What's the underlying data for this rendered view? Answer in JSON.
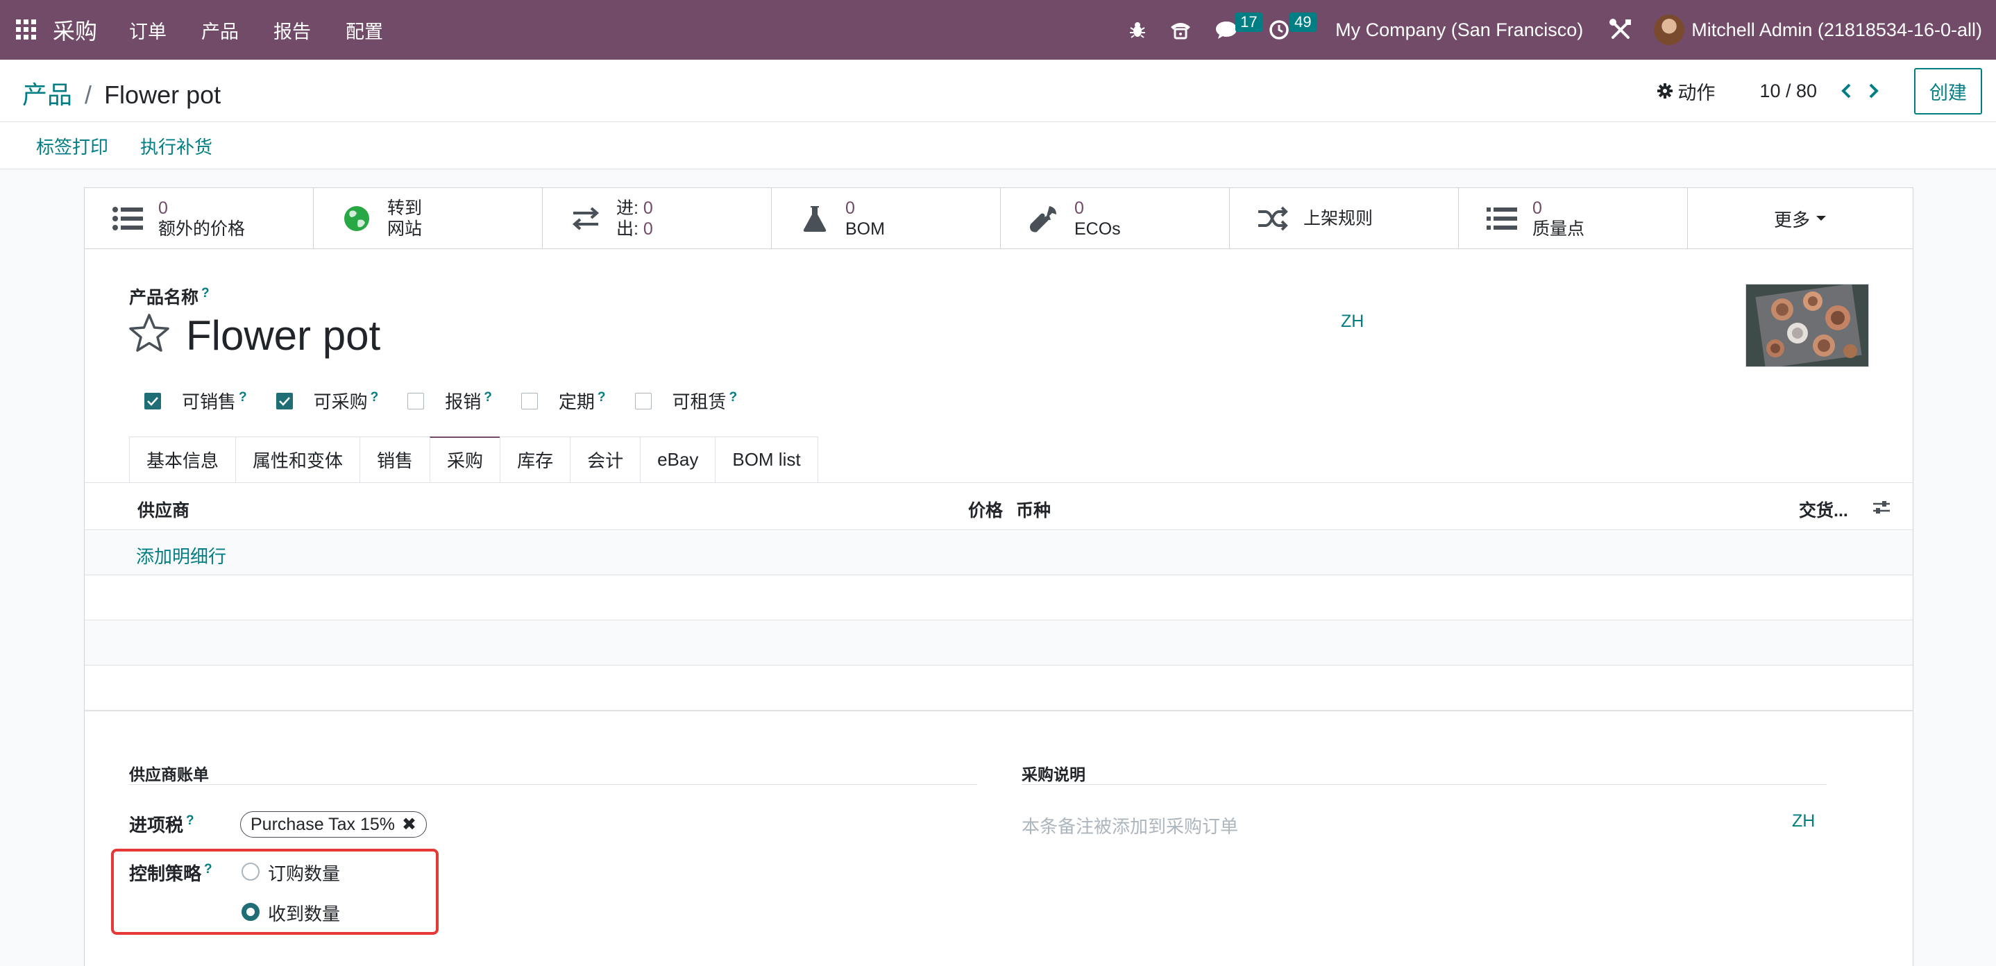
{
  "navbar": {
    "app_name": "采购",
    "menus": [
      "订单",
      "产品",
      "报告",
      "配置"
    ],
    "messages_count": "17",
    "activities_count": "49",
    "company": "My Company (San Francisco)",
    "user": "Mitchell Admin (21818534-16-0-all)",
    "color": "#714B67"
  },
  "control_panel": {
    "breadcrumb_parent": "产品",
    "breadcrumb_sep": "/",
    "breadcrumb_current": "Flower pot",
    "action_label": "动作",
    "pager": "10 / 80",
    "create_label": "创建"
  },
  "header_buttons": [
    "标签打印",
    "执行补货"
  ],
  "smart_buttons": [
    {
      "value": "0",
      "label": "额外的价格",
      "icon": "list-icon"
    },
    {
      "value": "转到",
      "label": "网站",
      "icon": "globe-icon"
    },
    {
      "in_label": "进:",
      "in_value": "0",
      "out_label": "出:",
      "out_value": "0",
      "icon": "transfer-icon"
    },
    {
      "value": "0",
      "label": "BOM",
      "icon": "flask-icon"
    },
    {
      "value": "0",
      "label": "ECOs",
      "icon": "wrench-icon"
    },
    {
      "label": "上架规则",
      "icon": "shuffle-icon"
    },
    {
      "value": "0",
      "label": "质量点",
      "icon": "list-icon"
    },
    {
      "label": "更多",
      "icon": "caret-down-icon"
    }
  ],
  "product": {
    "name_label": "产品名称",
    "help": "?",
    "name": "Flower pot",
    "lang": "ZH"
  },
  "checkboxes": [
    {
      "label": "可销售",
      "checked": true
    },
    {
      "label": "可采购",
      "checked": true
    },
    {
      "label": "报销",
      "checked": false
    },
    {
      "label": "定期",
      "checked": false
    },
    {
      "label": "可租赁",
      "checked": false
    }
  ],
  "tabs": [
    "基本信息",
    "属性和变体",
    "销售",
    "采购",
    "库存",
    "会计",
    "eBay",
    "BOM list"
  ],
  "active_tab": "采购",
  "vendor_table": {
    "columns": {
      "vendor": "供应商",
      "price": "价格",
      "currency": "币种",
      "delivery": "交货..."
    },
    "add_line": "添加明细行"
  },
  "vendor_bills": {
    "title": "供应商账单",
    "tax_label": "进项税",
    "tax_tag": "Purchase Tax 15%",
    "tax_tag_remove": "✖",
    "control_label": "控制策略",
    "options": [
      {
        "label": "订购数量",
        "selected": false
      },
      {
        "label": "收到数量",
        "selected": true
      }
    ]
  },
  "purchase_desc": {
    "title": "采购说明",
    "placeholder": "本条备注被添加到采购订单",
    "lang": "ZH"
  }
}
